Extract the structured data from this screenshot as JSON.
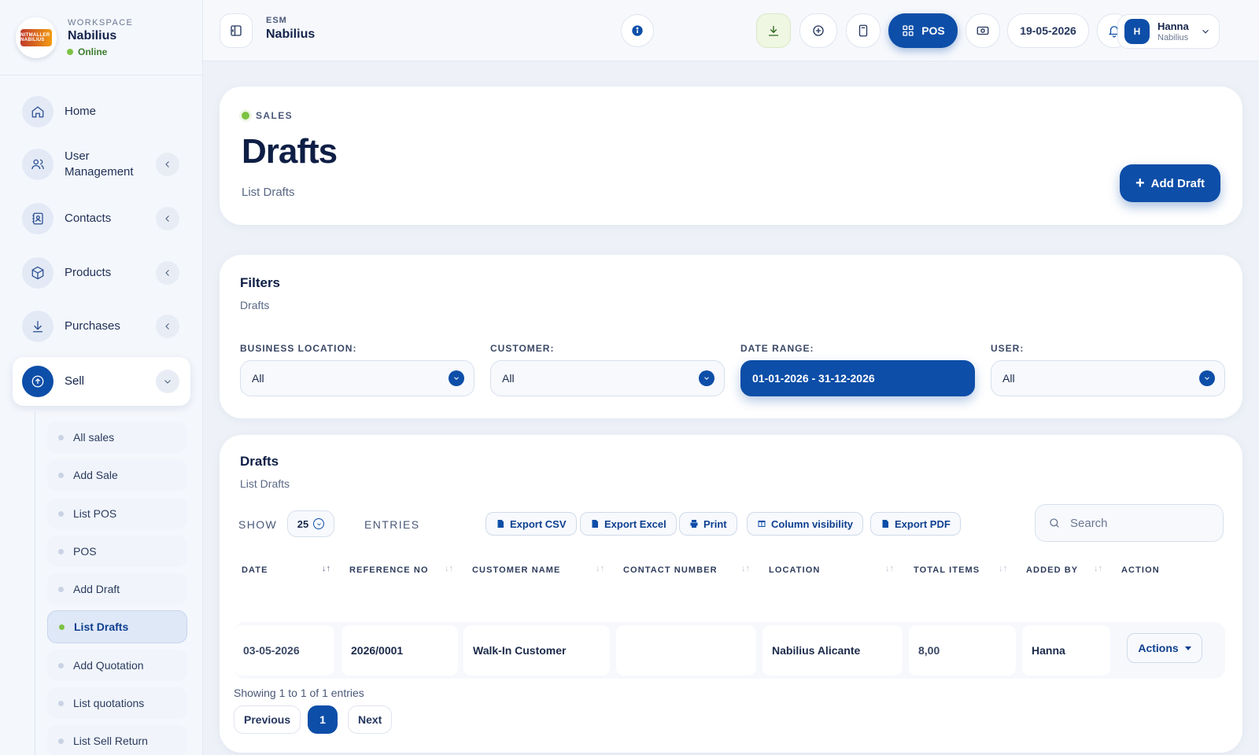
{
  "workspace": {
    "kicker": "WORKSPACE",
    "name": "Nabilius",
    "status": "Online",
    "logo_text": "NITMALLER NABILIUS"
  },
  "sidebar": {
    "items": [
      {
        "label": "Home",
        "icon": "home-icon"
      },
      {
        "label": "User Management",
        "icon": "users-icon"
      },
      {
        "label": "Contacts",
        "icon": "contacts-icon"
      },
      {
        "label": "Products",
        "icon": "box-icon"
      },
      {
        "label": "Purchases",
        "icon": "download-icon"
      },
      {
        "label": "Sell",
        "icon": "upload-icon"
      }
    ],
    "sub_items": [
      "All sales",
      "Add Sale",
      "List POS",
      "POS",
      "Add Draft",
      "List Drafts",
      "Add Quotation",
      "List quotations",
      "List Sell Return"
    ],
    "active_sub": "List Drafts"
  },
  "topbar": {
    "kicker": "ESM",
    "name": "Nabilius",
    "pos_label": "POS",
    "date": "19-05-2026",
    "user": {
      "initial": "H",
      "name": "Hanna",
      "org": "Nabilius"
    }
  },
  "hero": {
    "kicker": "SALES",
    "title": "Drafts",
    "subtitle": "List Drafts",
    "add_label": "Add Draft"
  },
  "filters": {
    "title": "Filters",
    "subtitle": "Drafts",
    "fields": [
      {
        "label": "BUSINESS LOCATION:",
        "value": "All"
      },
      {
        "label": "CUSTOMER:",
        "value": "All"
      },
      {
        "label": "DATE RANGE:",
        "value": "01-01-2026 - 31-12-2026"
      },
      {
        "label": "USER:",
        "value": "All"
      }
    ]
  },
  "table": {
    "title": "Drafts",
    "subtitle": "List Drafts",
    "show_label": "SHOW",
    "per_page": "25",
    "entries_label": "ENTRIES",
    "exports": [
      "Export CSV",
      "Export Excel",
      "Print",
      "Column visibility",
      "Export PDF"
    ],
    "search_placeholder": "Search",
    "columns": [
      "DATE",
      "REFERENCE NO",
      "CUSTOMER NAME",
      "CONTACT NUMBER",
      "LOCATION",
      "TOTAL ITEMS",
      "ADDED BY",
      "ACTION"
    ],
    "rows": [
      {
        "date": "03-05-2026",
        "ref": "2026/0001",
        "customer": "Walk-In Customer",
        "contact": "",
        "location": "Nabilius Alicante",
        "items": "8,00",
        "added_by": "Hanna",
        "action": "Actions"
      }
    ],
    "showing": "Showing 1 to 1 of 1 entries",
    "pagination": {
      "prev": "Previous",
      "current": "1",
      "next": "Next"
    }
  },
  "colors": {
    "primary": "#0d4ea8",
    "online": "#7cc242",
    "background": "#eef2f8"
  }
}
